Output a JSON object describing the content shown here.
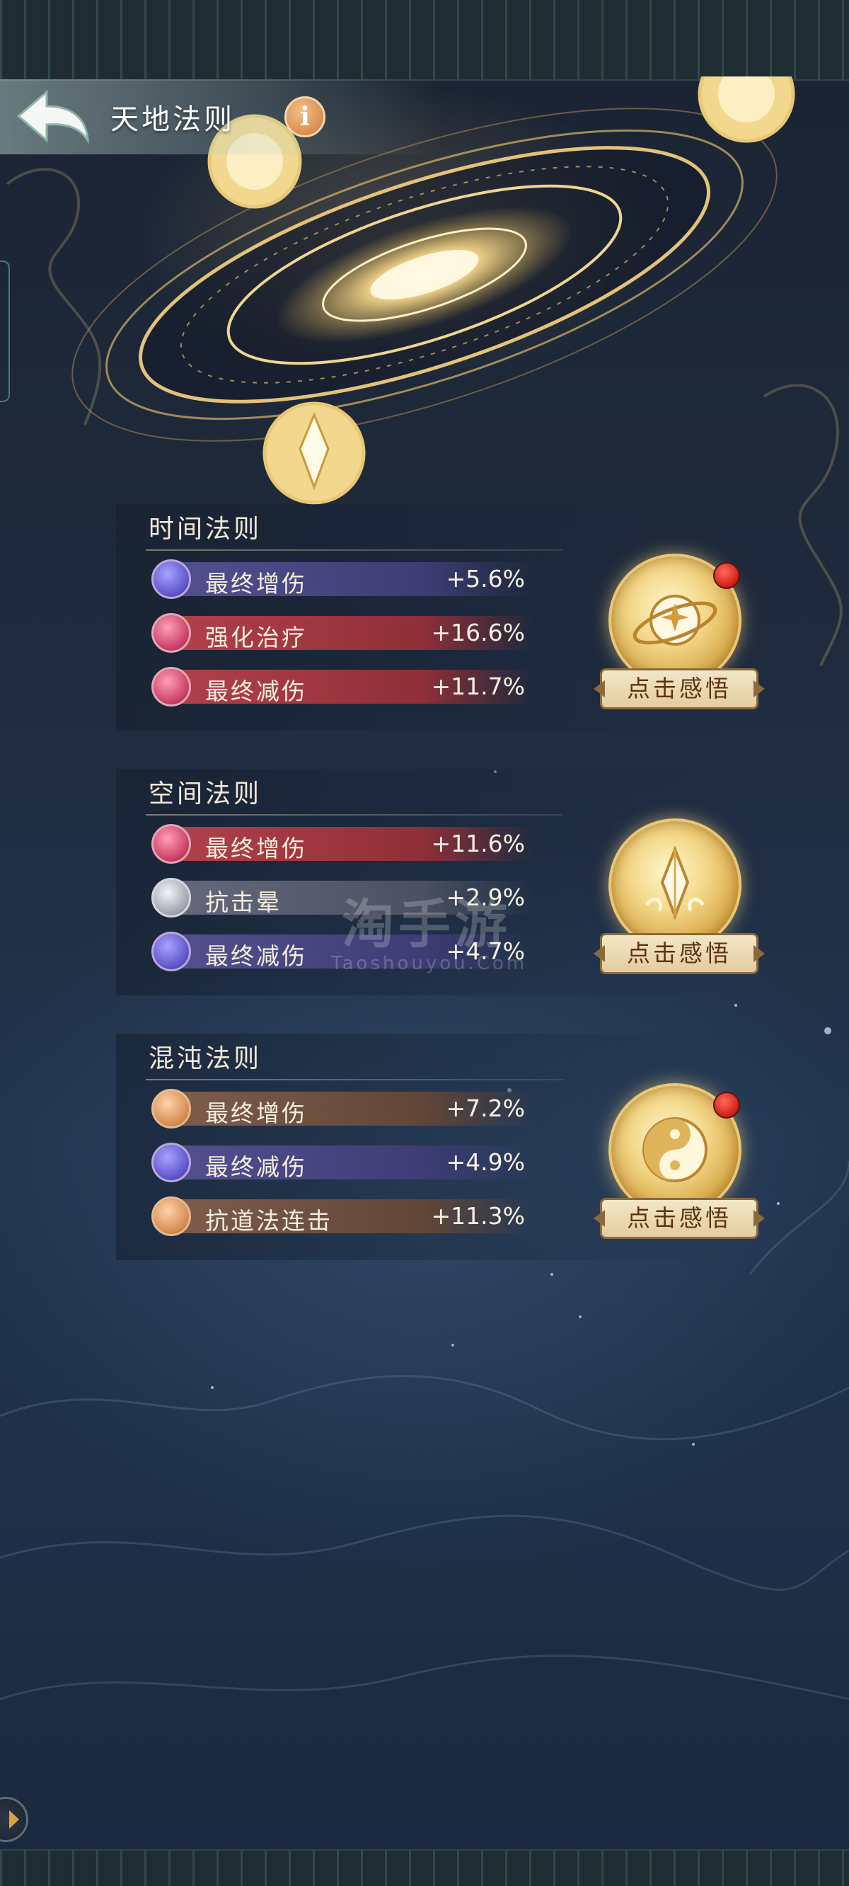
{
  "header": {
    "title": "天地法则",
    "info_label": "i"
  },
  "sections": [
    {
      "title": "时间法则",
      "stats": [
        {
          "label": "最终增伤",
          "value": "+5.6%"
        },
        {
          "label": "强化治疗",
          "value": "+16.6%"
        },
        {
          "label": "最终减伤",
          "value": "+11.7%"
        }
      ],
      "button_label": "点击感悟",
      "has_notification": true
    },
    {
      "title": "空间法则",
      "stats": [
        {
          "label": "最终增伤",
          "value": "+11.6%"
        },
        {
          "label": "抗击晕",
          "value": "+2.9%"
        },
        {
          "label": "最终减伤",
          "value": "+4.7%"
        }
      ],
      "button_label": "点击感悟",
      "has_notification": false
    },
    {
      "title": "混沌法则",
      "stats": [
        {
          "label": "最终增伤",
          "value": "+7.2%"
        },
        {
          "label": "最终减伤",
          "value": "+4.9%"
        },
        {
          "label": "抗道法连击",
          "value": "+11.3%"
        }
      ],
      "button_label": "点击感悟",
      "has_notification": true
    }
  ],
  "watermark": {
    "main": "淘手游",
    "sub": "Taoshouyou.Com"
  },
  "colors": {
    "bar_purple": "#4b4a8c",
    "bar_red": "#a8383f",
    "bar_gray": "#5a5f6e",
    "bar_bronze": "#7a5a48",
    "gold": "#e9c774",
    "button_text": "#5b3413"
  },
  "icons": [
    "back-arrow-icon",
    "info-icon",
    "time-law-icon",
    "space-law-icon",
    "chaos-law-icon"
  ]
}
